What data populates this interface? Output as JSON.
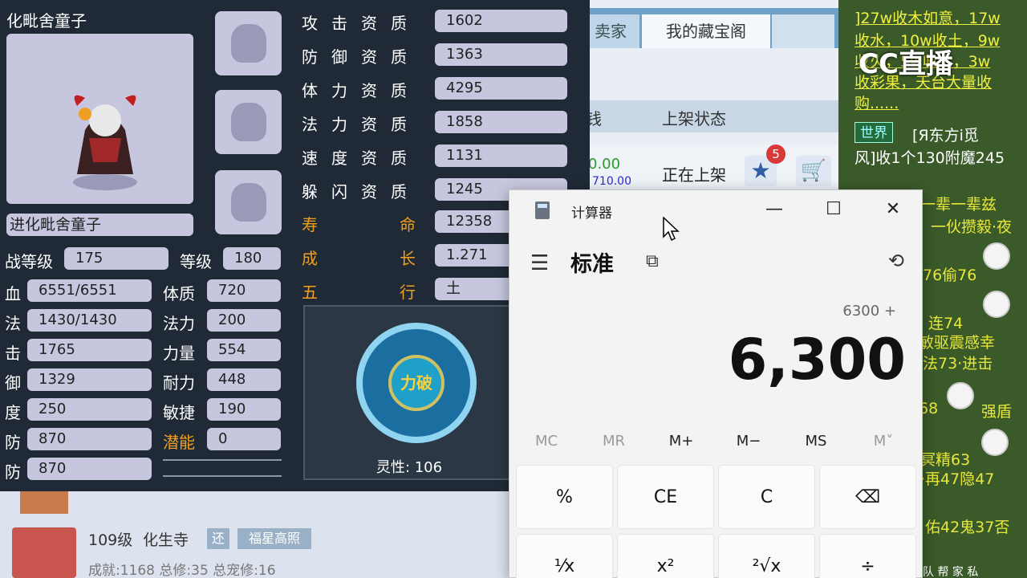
{
  "trade": {
    "tabs": [
      "卖家",
      "我的藏宝阁",
      ""
    ],
    "col_price": "钱",
    "col_status": "上架状态",
    "row_price": "0.00",
    "row_price2": "710.00",
    "row_status": "正在上架",
    "badge_count": "5"
  },
  "chat": {
    "lines": [
      "]27w收木如意，17w",
      "收水，10w收土，9w",
      "收火，5w收金，3w",
      "收彩果，天台大量收",
      "购......"
    ],
    "world_badge": "世界",
    "world_line1": "[Я东方i觅",
    "world_line2": "风]收1个130附魔245",
    "side_lines": [
      "一辈一辈兹",
      "一伙攒毅·夜",
      "76偷76",
      "连74",
      "敏驱震感幸",
      "法73·进击",
      "68",
      "强盾",
      "冥精63",
      "·再47隐47",
      "佑42鬼37否"
    ],
    "logo": "CC直播",
    "bottom": "队 帮 家 私"
  },
  "char": {
    "name_top": "化毗舍童子",
    "name_bar": "进化毗舍童子",
    "qualities": [
      {
        "label": "攻击资质",
        "value": "1602"
      },
      {
        "label": "防御资质",
        "value": "1363"
      },
      {
        "label": "体力资质",
        "value": "4295"
      },
      {
        "label": "法力资质",
        "value": "1858"
      },
      {
        "label": "速度资质",
        "value": "1131"
      },
      {
        "label": "躲闪资质",
        "value": "1245"
      }
    ],
    "lifespan_label1": "寿",
    "lifespan_label2": "命",
    "lifespan": "12358",
    "growth_label1": "成",
    "growth_label2": "长",
    "growth": "1.271",
    "element_label1": "五",
    "element_label2": "行",
    "element": "土",
    "battle_level_label": "战等级",
    "battle_level": "175",
    "level_label": "等级",
    "level": "180",
    "left_stats": [
      {
        "label": "血",
        "value": "6551/6551"
      },
      {
        "label": "法",
        "value": "1430/1430"
      },
      {
        "label": "击",
        "value": "1765"
      },
      {
        "label": "御",
        "value": "1329"
      },
      {
        "label": "度",
        "value": "250"
      },
      {
        "label": "防",
        "value": "870"
      },
      {
        "label": "防",
        "value": "870"
      }
    ],
    "right_stats": [
      {
        "label": "体质",
        "value": "720"
      },
      {
        "label": "法力",
        "value": "200"
      },
      {
        "label": "力量",
        "value": "554"
      },
      {
        "label": "耐力",
        "value": "448"
      },
      {
        "label": "敏捷",
        "value": "190"
      },
      {
        "label": "潜能",
        "value": "0"
      }
    ],
    "spirit_center": "力破",
    "spirit_label": "灵性: 106"
  },
  "lower": {
    "level": "109级",
    "school": "化生寺",
    "tag1": "还",
    "tag2": "福星高照",
    "achievement": "成就:1168 总修:35 总宠修:16"
  },
  "calc": {
    "title": "计算器",
    "mode": "标准",
    "expression": "6300 +",
    "display": "6,300",
    "memory": [
      "MC",
      "MR",
      "M+",
      "M−",
      "MS",
      "M˅"
    ],
    "keys_row1": [
      "%",
      "CE",
      "C",
      "⌫"
    ],
    "keys_row2": [
      "¹⁄x",
      "x²",
      "²√x",
      "÷"
    ]
  }
}
